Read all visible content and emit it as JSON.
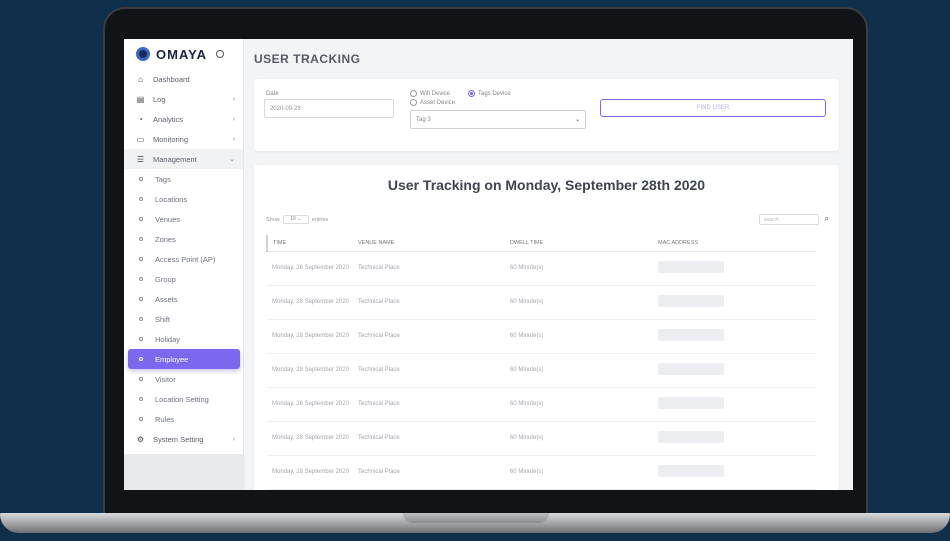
{
  "brand": {
    "name": "OMAYA"
  },
  "page_title": "USER TRACKING",
  "sidebar": {
    "items": [
      {
        "label": "Dashboard",
        "icon": "home-icon",
        "glyph": "⌂"
      },
      {
        "label": "Log",
        "icon": "log-icon",
        "glyph": "▤",
        "chevron": "›"
      },
      {
        "label": "Analytics",
        "icon": "analytics-icon",
        "glyph": "◔",
        "chevron": "›"
      },
      {
        "label": "Monitoring",
        "icon": "monitor-icon",
        "glyph": "▭",
        "chevron": "›"
      },
      {
        "label": "Management",
        "icon": "management-icon",
        "glyph": "☰",
        "chevron": "⌄"
      }
    ],
    "sub_items": [
      "Tags",
      "Locations",
      "Venues",
      "Zones",
      "Access Point (AP)",
      "Group",
      "Assets",
      "Shift",
      "Holiday",
      "Employee",
      "Visitor",
      "Location Setting",
      "Rules"
    ],
    "active_sub": "Employee",
    "footer_item": {
      "label": "System Setting",
      "icon": "settings-icon",
      "glyph": "⚙",
      "chevron": "›"
    }
  },
  "filter": {
    "date_label": "Date",
    "date_value": "2020-09-28",
    "radio_wifi": "Wifi Device",
    "radio_tags": "Tags Device",
    "radio_asset": "Asset Device",
    "tag_select": "Tag 3",
    "find_button": "FIND USER"
  },
  "results": {
    "title": "User Tracking on Monday, September 28th 2020",
    "show_label": "Show",
    "entries_value": "10",
    "entries_label": "entries",
    "search_placeholder": "search",
    "columns": [
      "TIME",
      "VENUE NAME",
      "DWELL TIME",
      "MAC ADDRESS"
    ],
    "rows": [
      {
        "time": "Monday, 28 September 2020",
        "venue": "Technical Place",
        "dwell": "60 Minute(s)"
      },
      {
        "time": "Monday, 28 September 2020",
        "venue": "Technical Place",
        "dwell": "60 Minute(s)"
      },
      {
        "time": "Monday, 28 September 2020",
        "venue": "Technical Place",
        "dwell": "60 Minute(s)"
      },
      {
        "time": "Monday, 28 September 2020",
        "venue": "Technical Place",
        "dwell": "60 Minute(s)"
      },
      {
        "time": "Monday, 28 September 2020",
        "venue": "Technical Place",
        "dwell": "60 Minute(s)"
      },
      {
        "time": "Monday, 28 September 2020",
        "venue": "Technical Place",
        "dwell": "60 Minute(s)"
      },
      {
        "time": "Monday, 28 September 2020",
        "venue": "Technical Place",
        "dwell": "60 Minute(s)"
      }
    ]
  },
  "colors": {
    "accent": "#7b68ee",
    "background": "#0f2f4a",
    "brand_dark": "#1b2245"
  }
}
